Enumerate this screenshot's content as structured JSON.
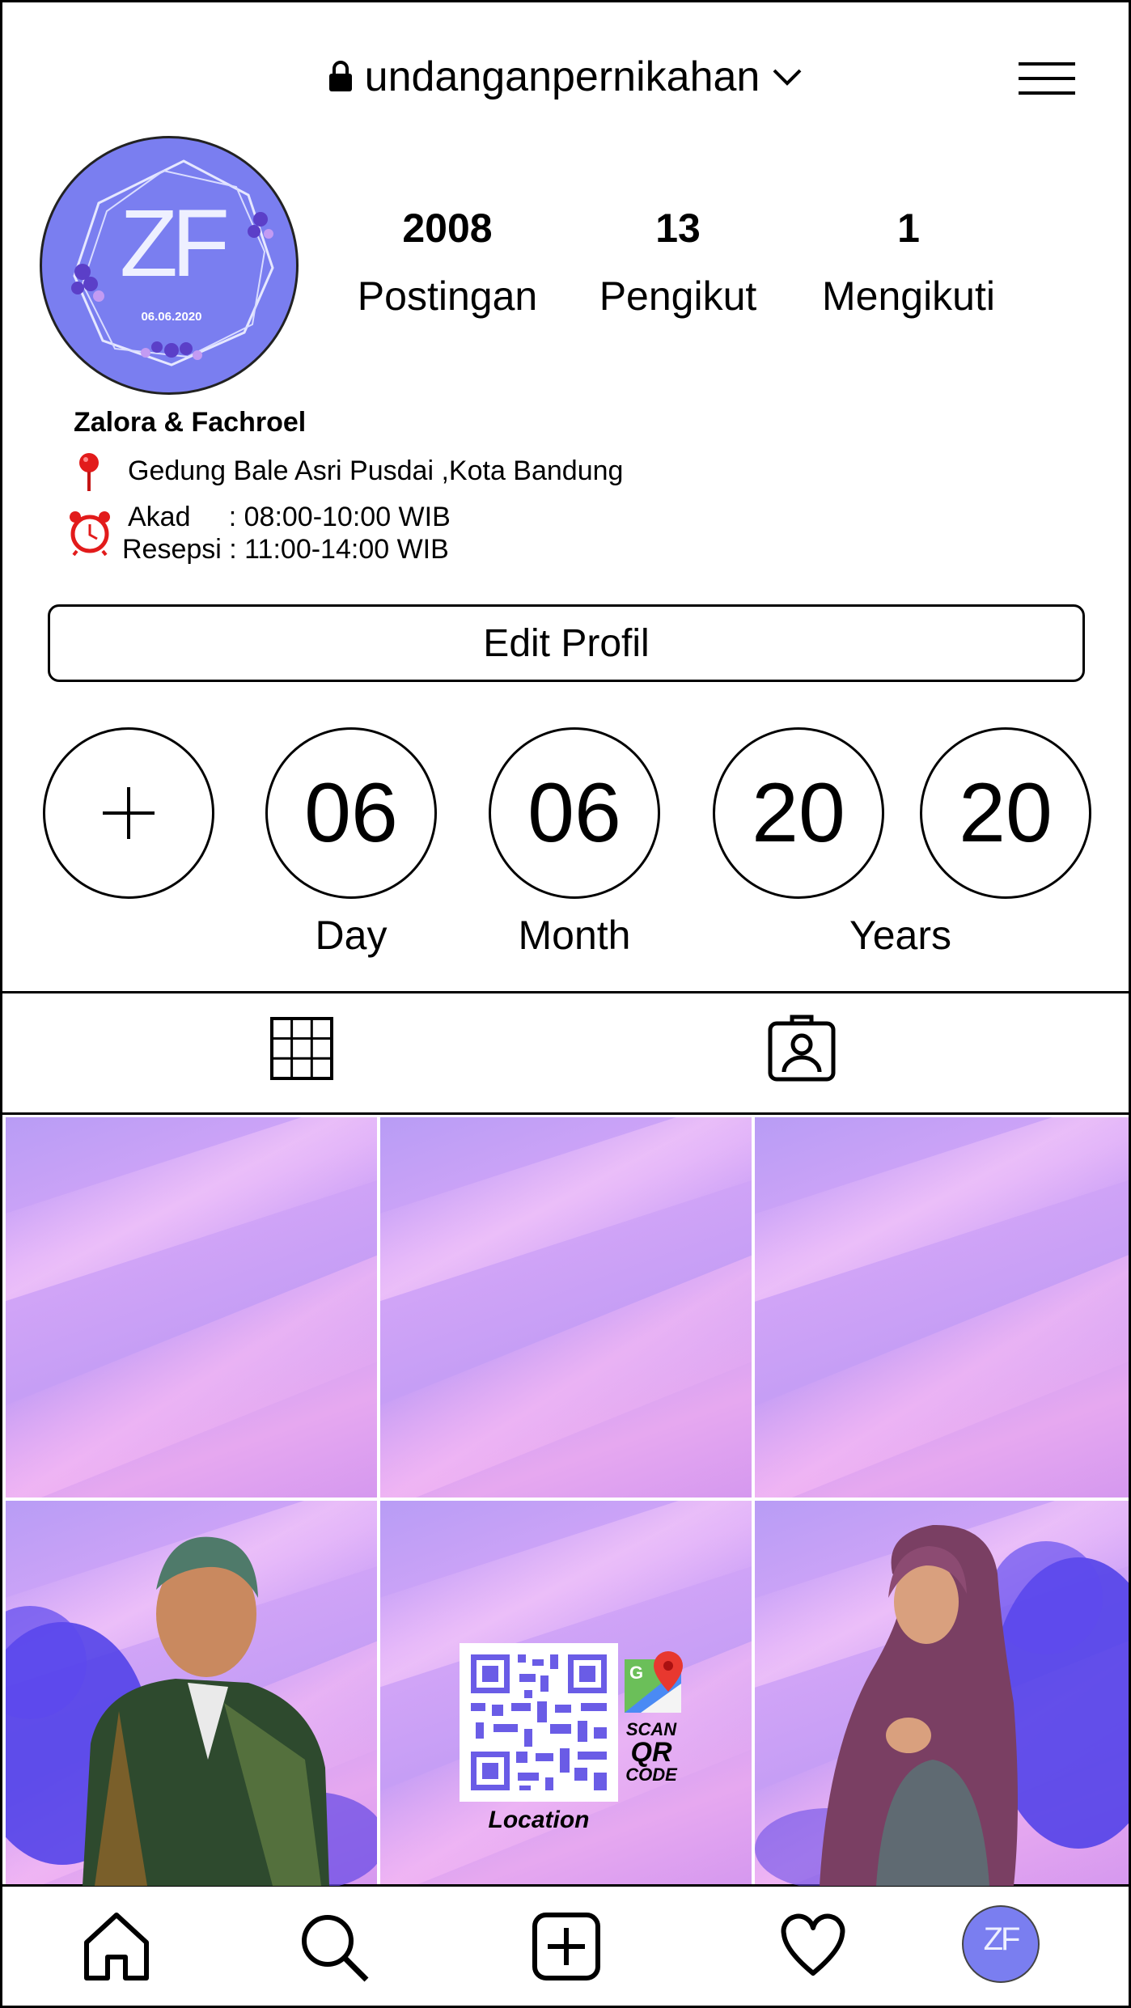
{
  "header": {
    "username": "undanganpernikahan",
    "lock_icon": "lock-icon",
    "dropdown_icon": "chevron-down-icon",
    "menu_icon": "hamburger-menu-icon"
  },
  "avatar": {
    "monogram": "ZF",
    "date": "06.06.2020",
    "bg_color": "#7a7ef0"
  },
  "stats": [
    {
      "value": "2008",
      "label": "Postingan"
    },
    {
      "value": "13",
      "label": "Pengikut"
    },
    {
      "value": "1",
      "label": "Mengikuti"
    }
  ],
  "bio": {
    "name": "Zalora & Fachroel",
    "location_icon": "pin-icon",
    "location": "Gedung Bale Asri Pusdai ,Kota Bandung",
    "clock_icon": "alarm-clock-icon",
    "akad": "Akad     : 08:00-10:00 WIB",
    "resepsi": "Resepsi : 11:00-14:00 WIB"
  },
  "edit_profile_label": "Edit Profil",
  "highlights": {
    "add": "+",
    "day": "06",
    "month": "06",
    "year1": "20",
    "year2": "20",
    "day_label": "Day",
    "month_label": "Month",
    "years_label": "Years"
  },
  "tabs": {
    "grid_icon": "grid-icon",
    "tagged_icon": "tagged-person-icon"
  },
  "posts": {
    "qr_caption": "Location",
    "scan_line1": "SCAN",
    "scan_line2": "QR",
    "scan_line3": "CODE",
    "maps_letter": "G"
  },
  "bottom_nav": {
    "home": "home-icon",
    "search": "search-icon",
    "add": "add-post-icon",
    "activity": "heart-icon",
    "profile": "profile-avatar-icon",
    "profile_monogram": "ZF"
  },
  "colors": {
    "avatar_purple": "#7a7ef0",
    "pin_red": "#e21b1b",
    "smoke_blue": "#4b3de8",
    "qr_purple": "#6a5ce6"
  }
}
